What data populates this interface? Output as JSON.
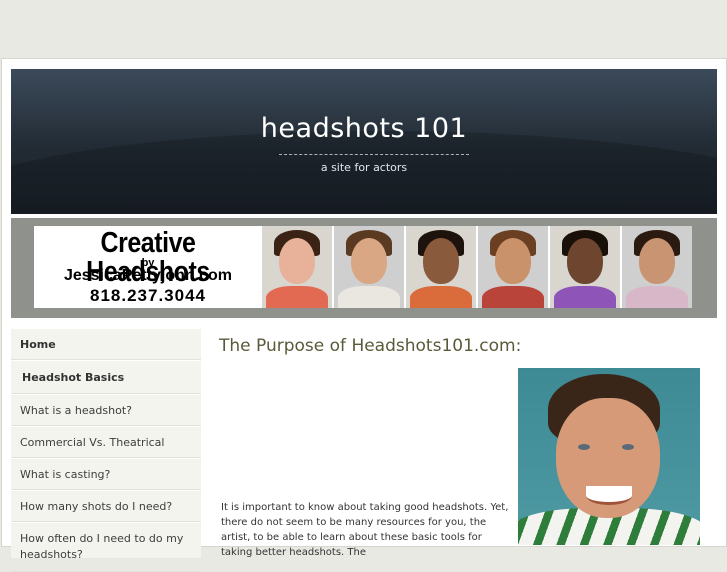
{
  "site": {
    "title": "headshots 101",
    "tagline": "a site for actors"
  },
  "banner": {
    "brand": "Creative Headshots",
    "by": "by",
    "website": "JessicaPettyjohn.com",
    "phone": "818.237.3044",
    "faces": [
      {
        "skin": "#e8b29a",
        "hair": "#3a2214",
        "top": "#e26a52"
      },
      {
        "skin": "#d9a784",
        "hair": "#5a3b22",
        "top": "#eae6e0"
      },
      {
        "skin": "#8a5a3c",
        "hair": "#1e130c",
        "top": "#d96c3a"
      },
      {
        "skin": "#c9926b",
        "hair": "#6b3f22",
        "top": "#b8443a"
      },
      {
        "skin": "#6e4630",
        "hair": "#1a100a",
        "top": "#8e54b8"
      },
      {
        "skin": "#c99472",
        "hair": "#2b1a10",
        "top": "#d8b8c8"
      }
    ]
  },
  "nav": {
    "items": [
      {
        "label": "Home",
        "kind": "home"
      },
      {
        "label": "Headshot Basics",
        "kind": "section"
      },
      {
        "label": "What is a headshot?",
        "kind": "link"
      },
      {
        "label": "Commercial Vs. Theatrical",
        "kind": "link"
      },
      {
        "label": "What is casting?",
        "kind": "link"
      },
      {
        "label": "How many shots do I need?",
        "kind": "link"
      },
      {
        "label": "How often do I need to do my headshots?",
        "kind": "multi"
      }
    ]
  },
  "main": {
    "heading": "The Purpose of Headshots101.com:",
    "body": "It is important to know about taking good headshots. Yet, there do not seem to be many resources for you, the artist, to be able to learn about these basic tools for taking better headshots. The"
  },
  "colors": {
    "background": "#e9e9e3",
    "header": "#222b34",
    "banner": "#8f918c",
    "sidebar": "#f4f4ee",
    "heading": "#5a5a3a"
  }
}
